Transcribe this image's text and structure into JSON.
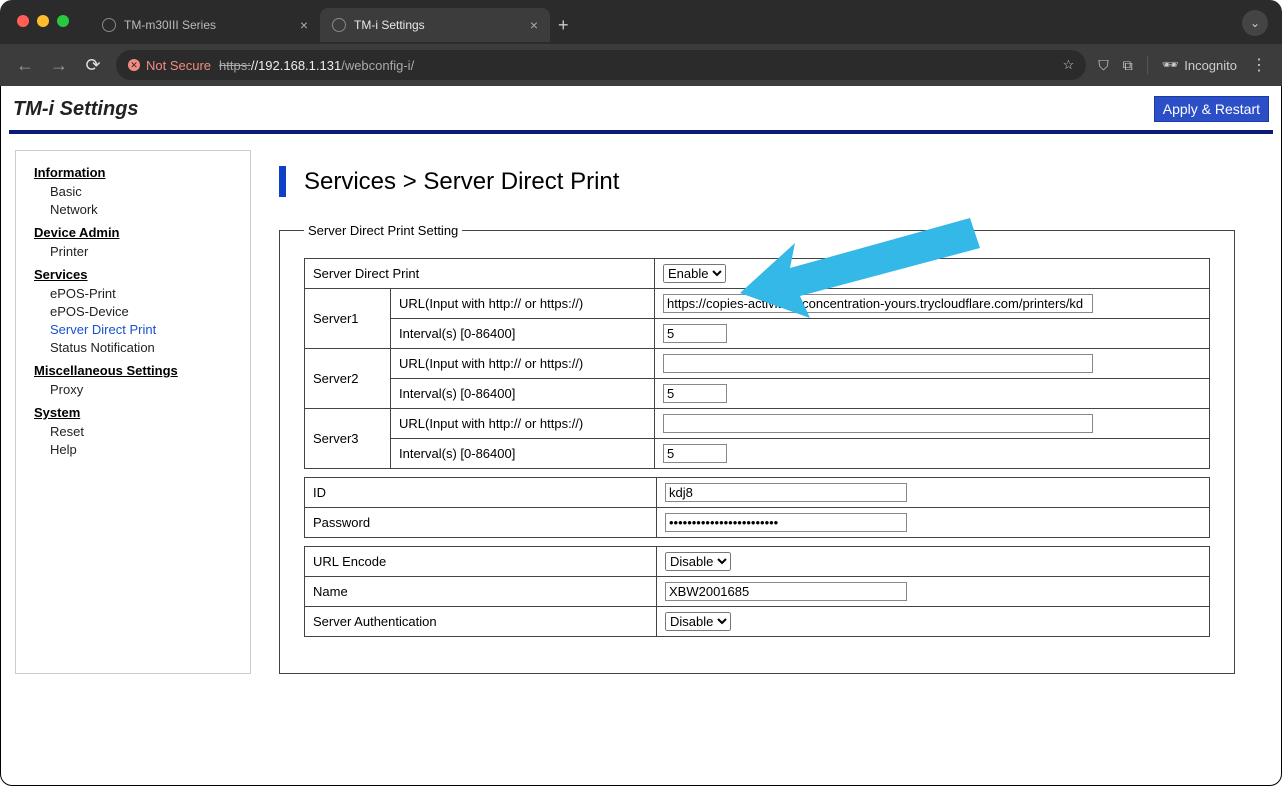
{
  "browser": {
    "tabs": [
      {
        "title": "TM-m30III Series",
        "active": false
      },
      {
        "title": "TM-i Settings",
        "active": true
      }
    ],
    "not_secure": "Not Secure",
    "url_proto": "https:",
    "url_host": "//192.168.1.131",
    "url_path": "/webconfig-i/",
    "incognito": "Incognito"
  },
  "header": {
    "title": "TM-i Settings",
    "apply": "Apply & Restart"
  },
  "sidebar": {
    "information": {
      "head": "Information",
      "basic": "Basic",
      "network": "Network"
    },
    "device_admin": {
      "head": "Device Admin",
      "printer": "Printer"
    },
    "services": {
      "head": "Services",
      "epos_print": "ePOS-Print",
      "epos_device": "ePOS-Device",
      "sdp": "Server Direct Print",
      "status": "Status Notification"
    },
    "misc": {
      "head": "Miscellaneous Settings",
      "proxy": "Proxy"
    },
    "system": {
      "head": "System",
      "reset": "Reset",
      "help": "Help"
    }
  },
  "main": {
    "title": "Services > Server Direct Print",
    "legend": "Server Direct Print Setting",
    "labels": {
      "sdp": "Server Direct Print",
      "server1": "Server1",
      "server2": "Server2",
      "server3": "Server3",
      "url": "URL(Input with http:// or https://)",
      "interval": "Interval(s) [0-86400]",
      "id": "ID",
      "password": "Password",
      "url_encode": "URL Encode",
      "name": "Name",
      "server_auth": "Server Authentication"
    },
    "values": {
      "sdp_select": "Enable",
      "url1": "https://copies-activities-concentration-yours.trycloudflare.com/printers/kd",
      "int1": "5",
      "url2": "",
      "int2": "5",
      "url3": "",
      "int3": "5",
      "id": "kdj8",
      "password": "••••••••••••••••••••••••",
      "url_encode": "Disable",
      "name": "XBW2001685",
      "server_auth": "Disable"
    }
  }
}
